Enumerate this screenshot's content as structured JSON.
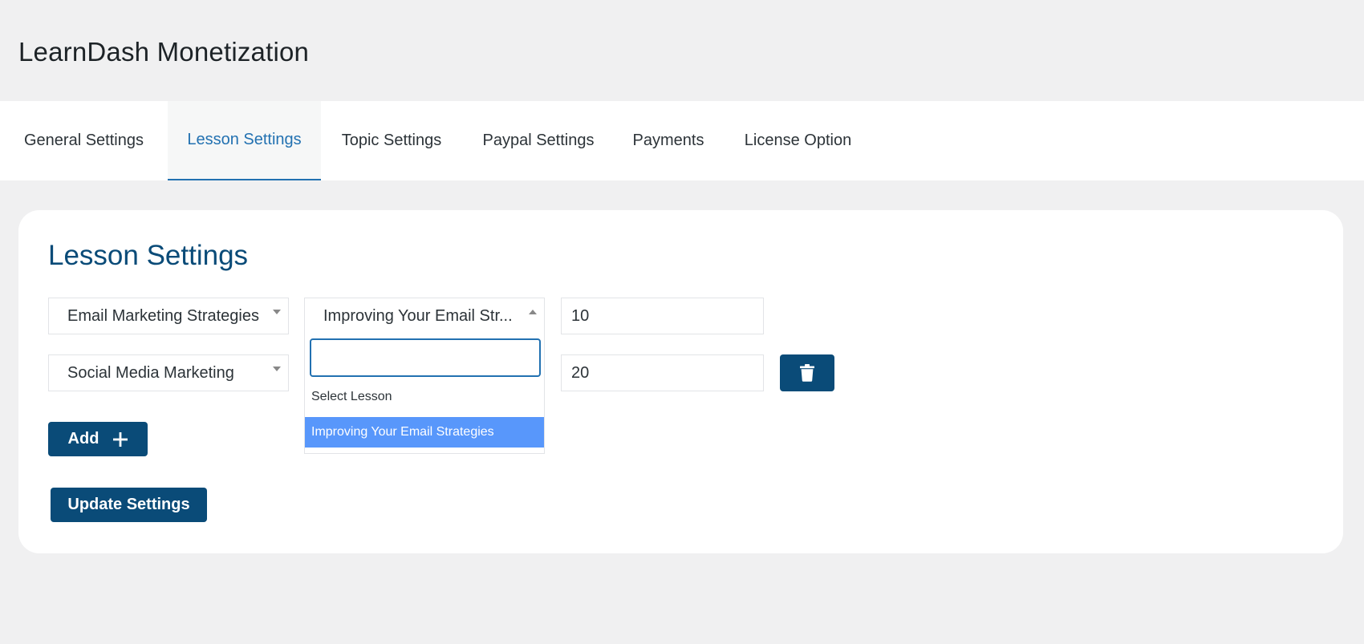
{
  "page": {
    "title": "LearnDash Monetization"
  },
  "tabs": [
    {
      "label": "General Settings",
      "active": false
    },
    {
      "label": "Lesson Settings",
      "active": true
    },
    {
      "label": "Topic Settings",
      "active": false
    },
    {
      "label": "Paypal Settings",
      "active": false
    },
    {
      "label": "Payments",
      "active": false
    },
    {
      "label": "License Option",
      "active": false
    }
  ],
  "card": {
    "title": "Lesson Settings",
    "rows": [
      {
        "course": "Email Marketing Strategies",
        "lesson": "Improving Your Email Str...",
        "price": "10"
      },
      {
        "course": "Social Media Marketing",
        "lesson": "",
        "price": "20"
      }
    ],
    "add_label": "Add",
    "update_label": "Update Settings"
  },
  "dropdown": {
    "search_value": "",
    "options": [
      {
        "label": "Select Lesson",
        "highlighted": false
      },
      {
        "label": "Improving Your Email Strategies",
        "highlighted": true
      }
    ]
  },
  "colors": {
    "primary": "#0a4b78",
    "accent": "#2271b1",
    "highlight": "#5897fb",
    "background": "#f0f0f1"
  },
  "icons": {
    "delete": "trash-icon",
    "add": "plus-icon",
    "dropdown": "caret-down-icon"
  }
}
